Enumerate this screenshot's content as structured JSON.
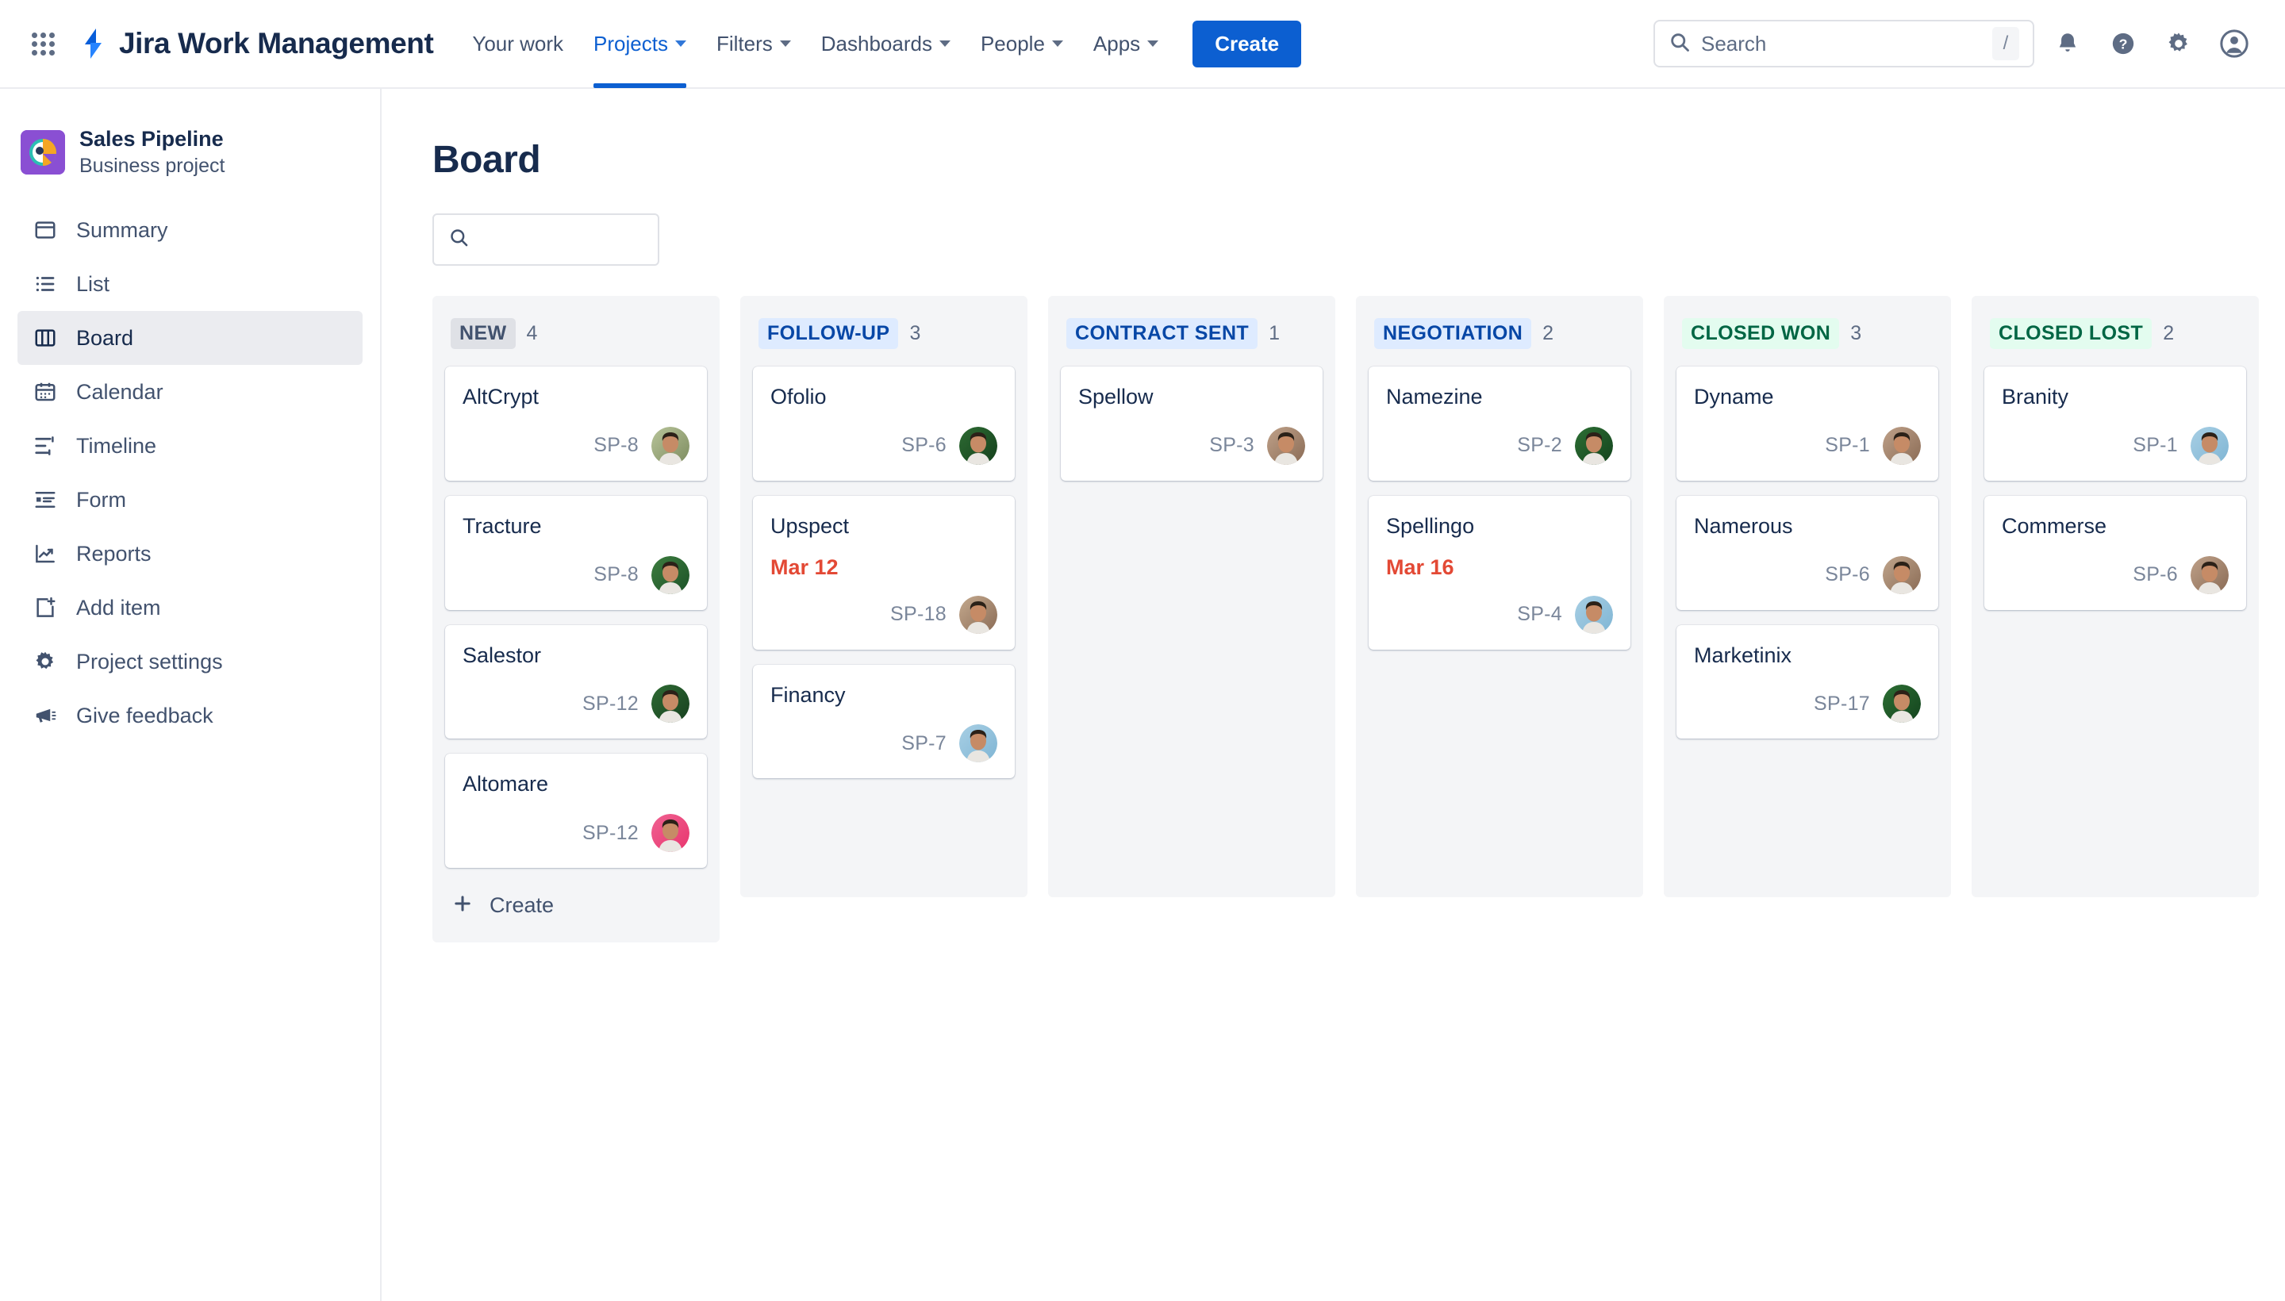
{
  "topnav": {
    "app_switcher_label": "App switcher",
    "brand": "Jira Work Management",
    "links": [
      {
        "label": "Your work",
        "has_caret": false,
        "active": false
      },
      {
        "label": "Projects",
        "has_caret": true,
        "active": true
      },
      {
        "label": "Filters",
        "has_caret": true,
        "active": false
      },
      {
        "label": "Dashboards",
        "has_caret": true,
        "active": false
      },
      {
        "label": "People",
        "has_caret": true,
        "active": false
      },
      {
        "label": "Apps",
        "has_caret": true,
        "active": false
      }
    ],
    "create_label": "Create",
    "search_placeholder": "Search",
    "search_value": "",
    "search_shortcut": "/",
    "accent_color": "#0c5fd1"
  },
  "sidebar": {
    "project_name": "Sales Pipeline",
    "project_type": "Business project",
    "project_avatar_color": "#8a4fd3",
    "items": [
      {
        "label": "Summary",
        "icon": "summary-icon",
        "selected": false
      },
      {
        "label": "List",
        "icon": "list-icon",
        "selected": false
      },
      {
        "label": "Board",
        "icon": "board-icon",
        "selected": true
      },
      {
        "label": "Calendar",
        "icon": "calendar-icon",
        "selected": false
      },
      {
        "label": "Timeline",
        "icon": "timeline-icon",
        "selected": false
      },
      {
        "label": "Form",
        "icon": "form-icon",
        "selected": false
      },
      {
        "label": "Reports",
        "icon": "reports-icon",
        "selected": false
      },
      {
        "label": "Add item",
        "icon": "add-item-icon",
        "selected": false
      },
      {
        "label": "Project settings",
        "icon": "gear-icon",
        "selected": false
      },
      {
        "label": "Give feedback",
        "icon": "megaphone-icon",
        "selected": false
      }
    ]
  },
  "main": {
    "page_title": "Board",
    "filter_search_value": "",
    "filter_search_placeholder": "",
    "create_card_label": "Create",
    "due_date_color": "#e34935"
  },
  "board": {
    "columns": [
      {
        "name": "NEW",
        "count": "4",
        "badge_bg": "#dfe1e6",
        "badge_color": "#42526e",
        "show_create": true,
        "cards": [
          {
            "title": "AltCrypt",
            "key": "SP-8",
            "due": "",
            "avatar_a": "#7d8c5f",
            "avatar_b": "#b8c49a"
          },
          {
            "title": "Tracture",
            "key": "SP-8",
            "due": "",
            "avatar_a": "#1c5228",
            "avatar_b": "#3d7d3f"
          },
          {
            "title": "Salestor",
            "key": "SP-12",
            "due": "",
            "avatar_a": "#17401f",
            "avatar_b": "#2f6b34"
          },
          {
            "title": "Altomare",
            "key": "SP-12",
            "due": "",
            "avatar_a": "#e8356d",
            "avatar_b": "#f06292"
          }
        ]
      },
      {
        "name": "FOLLOW-UP",
        "count": "3",
        "badge_bg": "#deebff",
        "badge_color": "#0747a6",
        "show_create": false,
        "cards": [
          {
            "title": "Ofolio",
            "key": "SP-6",
            "due": "",
            "avatar_a": "#14401c",
            "avatar_b": "#2e6b33"
          },
          {
            "title": "Upspect",
            "key": "SP-18",
            "due": "Mar 12",
            "avatar_a": "#8a6b55",
            "avatar_b": "#c4a98e"
          },
          {
            "title": "Financy",
            "key": "SP-7",
            "due": "",
            "avatar_a": "#7fb5d4",
            "avatar_b": "#a8cfe4"
          }
        ]
      },
      {
        "name": "CONTRACT SENT",
        "count": "1",
        "badge_bg": "#deebff",
        "badge_color": "#0747a6",
        "show_create": false,
        "cards": [
          {
            "title": "Spellow",
            "key": "SP-3",
            "due": "",
            "avatar_a": "#8a6b55",
            "avatar_b": "#bfa189"
          }
        ]
      },
      {
        "name": "NEGOTIATION",
        "count": "2",
        "badge_bg": "#deebff",
        "badge_color": "#0747a6",
        "show_create": false,
        "cards": [
          {
            "title": "Namezine",
            "key": "SP-2",
            "due": "",
            "avatar_a": "#13431d",
            "avatar_b": "#2d6f34"
          },
          {
            "title": "Spellingo",
            "key": "SP-4",
            "due": "Mar 16",
            "avatar_a": "#7fb5d4",
            "avatar_b": "#a8cfe4"
          }
        ]
      },
      {
        "name": "CLOSED WON",
        "count": "3",
        "badge_bg": "#e3fcef",
        "badge_color": "#006644",
        "show_create": false,
        "cards": [
          {
            "title": "Dyname",
            "key": "SP-1",
            "due": "",
            "avatar_a": "#8a6b55",
            "avatar_b": "#bfa189"
          },
          {
            "title": "Namerous",
            "key": "SP-6",
            "due": "",
            "avatar_a": "#8a6b55",
            "avatar_b": "#c0a58c"
          },
          {
            "title": "Marketinix",
            "key": "SP-17",
            "due": "",
            "avatar_a": "#13431d",
            "avatar_b": "#2d6f34"
          }
        ]
      },
      {
        "name": "CLOSED LOST",
        "count": "2",
        "badge_bg": "#e3fcef",
        "badge_color": "#006644",
        "show_create": false,
        "cards": [
          {
            "title": "Branity",
            "key": "SP-1",
            "due": "",
            "avatar_a": "#7fb5d4",
            "avatar_b": "#a8cfe4"
          },
          {
            "title": "Commerse",
            "key": "SP-6",
            "due": "",
            "avatar_a": "#8a6b55",
            "avatar_b": "#bfa189"
          }
        ]
      }
    ]
  }
}
